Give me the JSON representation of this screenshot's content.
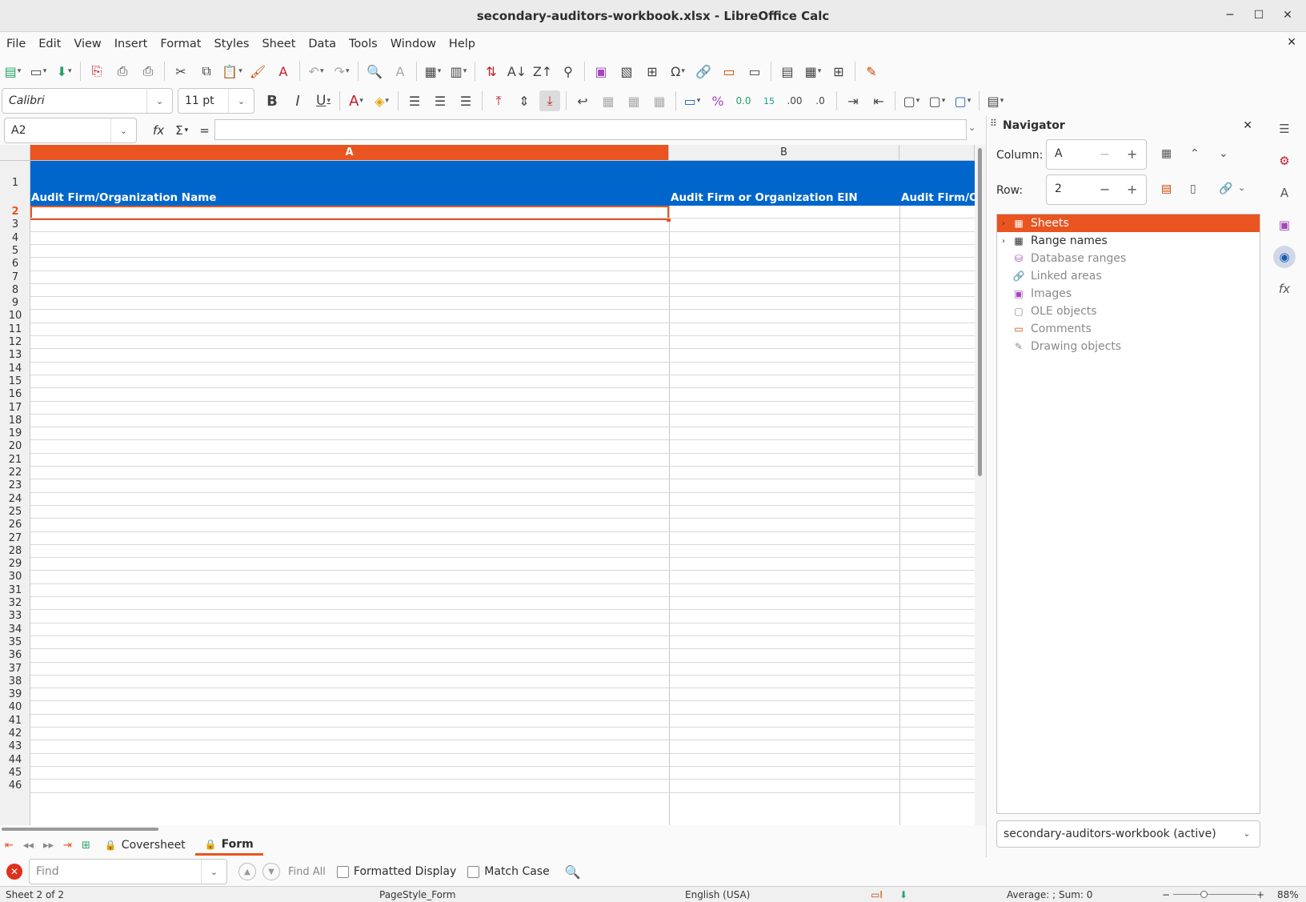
{
  "window": {
    "title": "secondary-auditors-workbook.xlsx - LibreOffice Calc",
    "minimize": "─",
    "maximize": "☐",
    "close": "✕"
  },
  "menu": [
    "File",
    "Edit",
    "View",
    "Insert",
    "Format",
    "Styles",
    "Sheet",
    "Data",
    "Tools",
    "Window",
    "Help"
  ],
  "menu_close": "✕",
  "font": {
    "name": "Calibri",
    "size": "11 pt"
  },
  "formula_bar": {
    "name_box": "A2",
    "fx": "fx",
    "sigma": "Σ",
    "equals": "=",
    "content": ""
  },
  "columns": [
    {
      "label": "A",
      "selected": true
    },
    {
      "label": "B",
      "selected": false
    },
    {
      "label": "",
      "selected": false
    }
  ],
  "header_row": [
    "Audit Firm/Organization Name",
    "Audit Firm or Organization EIN",
    "Audit Firm/O"
  ],
  "rows": [
    "1",
    "2",
    "3",
    "4",
    "5",
    "6",
    "7",
    "8",
    "9",
    "10",
    "11",
    "12",
    "13",
    "14",
    "15",
    "16",
    "17",
    "18",
    "19",
    "20",
    "21",
    "22",
    "23",
    "24",
    "25",
    "26",
    "27",
    "28",
    "29",
    "30",
    "31",
    "32",
    "33",
    "34",
    "35",
    "36",
    "37",
    "38",
    "39",
    "40",
    "41",
    "42",
    "43",
    "44",
    "45",
    "46"
  ],
  "selected_row": "2",
  "sheets": [
    {
      "name": "Coversheet",
      "active": false,
      "locked": true
    },
    {
      "name": "Form",
      "active": true,
      "locked": true
    }
  ],
  "find": {
    "placeholder": "Find",
    "find_all": "Find All",
    "formatted_display": "Formatted Display",
    "match_case": "Match Case"
  },
  "status": {
    "sheet": "Sheet 2 of 2",
    "page_style": "PageStyle_Form",
    "language": "English (USA)",
    "sum": "Average: ; Sum: 0",
    "zoom": "88%"
  },
  "navigator": {
    "title": "Navigator",
    "column_label": "Column:",
    "column_value": "A",
    "row_label": "Row:",
    "row_value": "2",
    "items": [
      {
        "label": "Sheets",
        "expandable": true,
        "selected": true,
        "enabled": true,
        "icon": "sheet-icon"
      },
      {
        "label": "Range names",
        "expandable": true,
        "selected": false,
        "enabled": true,
        "icon": "range-icon"
      },
      {
        "label": "Database ranges",
        "expandable": false,
        "selected": false,
        "enabled": false,
        "icon": "database-icon"
      },
      {
        "label": "Linked areas",
        "expandable": false,
        "selected": false,
        "enabled": false,
        "icon": "link-icon"
      },
      {
        "label": "Images",
        "expandable": false,
        "selected": false,
        "enabled": false,
        "icon": "image-icon"
      },
      {
        "label": "OLE objects",
        "expandable": false,
        "selected": false,
        "enabled": false,
        "icon": "ole-icon"
      },
      {
        "label": "Comments",
        "expandable": false,
        "selected": false,
        "enabled": false,
        "icon": "comment-icon"
      },
      {
        "label": "Drawing objects",
        "expandable": false,
        "selected": false,
        "enabled": false,
        "icon": "drawing-icon"
      }
    ],
    "document": "secondary-auditors-workbook (active)"
  },
  "colors": {
    "accent": "#e95420",
    "header_fill": "#0066cc"
  }
}
